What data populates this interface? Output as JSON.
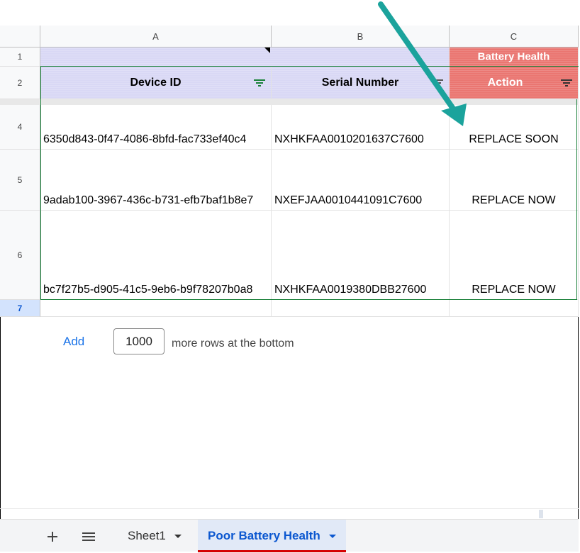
{
  "columns": [
    "A",
    "B",
    "C"
  ],
  "rows": [
    "1",
    "2",
    "4",
    "5",
    "6",
    "7"
  ],
  "header_row1": {
    "c": "Battery Health"
  },
  "header_row2": {
    "a": "Device ID",
    "b": "Serial Number",
    "c": "Action"
  },
  "data": [
    {
      "device_id": "6350d843-0f47-4086-8bfd-fac733ef40c4",
      "serial": "NXHKFAA0010201637C7600",
      "action": "REPLACE SOON"
    },
    {
      "device_id": "9adab100-3967-436c-b731-efb7baf1b8e7",
      "serial": "NXEFJAA0010441091C7600",
      "action": "REPLACE NOW"
    },
    {
      "device_id": "bc7f27b5-d905-41c5-9eb6-b9f78207b0a8",
      "serial": "NXHKFAA0019380DBB27600",
      "action": "REPLACE NOW"
    }
  ],
  "add_rows": {
    "button": "Add",
    "count": "1000",
    "suffix": "more rows at the bottom"
  },
  "tabs": {
    "sheet1": "Sheet1",
    "active": "Poor Battery Health"
  },
  "icons": {
    "add_sheet": "plus-icon",
    "all_sheets": "menu-icon",
    "filter": "filter-icon",
    "annotation": "teal-arrow"
  },
  "colors": {
    "header_purple": "#d9d8f5",
    "header_red": "#ea7671",
    "accent_blue": "#0b57d0",
    "arrow_teal": "#1ba39c",
    "active_tab_underline": "#d50000"
  }
}
